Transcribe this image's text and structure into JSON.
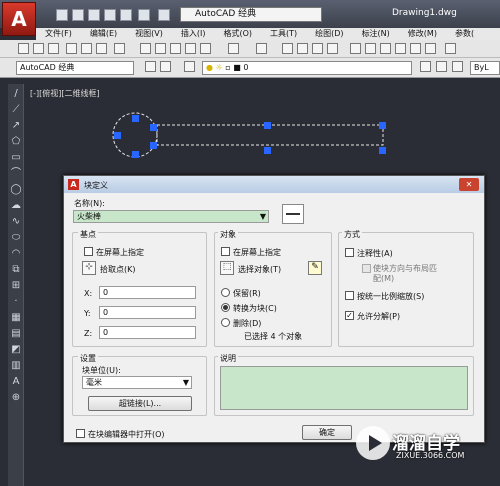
{
  "title_bar": {
    "workspace": "AutoCAD 经典",
    "document": "Drawing1.dwg",
    "logo": "A"
  },
  "menu": [
    "文件(F)",
    "编辑(E)",
    "视图(V)",
    "插入(I)",
    "格式(O)",
    "工具(T)",
    "绘图(D)",
    "标注(N)",
    "修改(M)",
    "参数("
  ],
  "toolbar2": {
    "workspace_combo": "AutoCAD 经典",
    "layer_value": "0",
    "linetype_value": "ByL"
  },
  "viewport_label": "[-][俯视][二维线框]",
  "dialog": {
    "title": "块定义",
    "name_label": "名称(N):",
    "name_value": "火柴棒",
    "basepoint": {
      "heading": "基点",
      "onscreen": "在屏幕上指定",
      "pick_button": "拾取点(K)",
      "x_label": "X:",
      "x_value": "0",
      "y_label": "Y:",
      "y_value": "0",
      "z_label": "Z:",
      "z_value": "0"
    },
    "objects": {
      "heading": "对象",
      "onscreen": "在屏幕上指定",
      "select_button": "选择对象(T)",
      "retain": "保留(R)",
      "convert": "转换为块(C)",
      "delete": "删除(D)",
      "selected_status": "已选择 4 个对象"
    },
    "behavior": {
      "heading": "方式",
      "annotative": "注释性(A)",
      "match_orientation": "使块方向与布局匹配(M)",
      "scale_uniformly": "按统一比例缩放(S)",
      "allow_explode": "允许分解(P)"
    },
    "settings": {
      "heading": "设置",
      "unit_label": "块单位(U):",
      "unit_value": "毫米",
      "hyperlink_button": "超链接(L)..."
    },
    "description": {
      "heading": "说明"
    },
    "open_in_editor": "在块编辑器中打开(O)",
    "ok_button": "确定",
    "close_symbol": "✕",
    "accent_color": "#c8e6c9"
  },
  "watermark": {
    "brand": "溜溜自学",
    "url": "ZIXUE.3066.COM"
  }
}
